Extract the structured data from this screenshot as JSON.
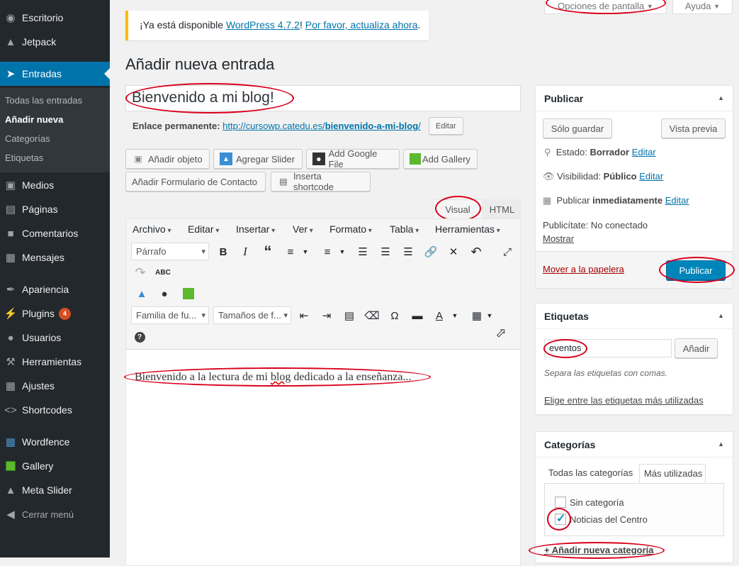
{
  "sidebar": {
    "items": [
      {
        "label": "Escritorio",
        "icon": "dashboard-icon"
      },
      {
        "label": "Jetpack",
        "icon": "jetpack-icon"
      },
      {
        "label": "Entradas",
        "icon": "pin-icon"
      },
      {
        "label": "Medios",
        "icon": "media-icon"
      },
      {
        "label": "Páginas",
        "icon": "pages-icon"
      },
      {
        "label": "Comentarios",
        "icon": "comments-icon"
      },
      {
        "label": "Mensajes",
        "icon": "messages-icon"
      },
      {
        "label": "Apariencia",
        "icon": "brush-icon"
      },
      {
        "label": "Plugins",
        "icon": "plugins-icon",
        "badge": "4"
      },
      {
        "label": "Usuarios",
        "icon": "users-icon"
      },
      {
        "label": "Herramientas",
        "icon": "tools-icon"
      },
      {
        "label": "Ajustes",
        "icon": "settings-icon"
      },
      {
        "label": "Shortcodes",
        "icon": "code-icon"
      },
      {
        "label": "Wordfence",
        "icon": "wordfence-icon"
      },
      {
        "label": "Gallery",
        "icon": "gallery-icon"
      },
      {
        "label": "Meta Slider",
        "icon": "slider-icon"
      },
      {
        "label": "Cerrar menú",
        "icon": "collapse-icon"
      }
    ],
    "submenu": [
      "Todas las entradas",
      "Añadir nueva",
      "Categorías",
      "Etiquetas"
    ]
  },
  "top": {
    "screen_options": "Opciones de pantalla",
    "help": "Ayuda"
  },
  "notice": {
    "prefix": "¡Ya está disponible ",
    "version_link": "WordPress 4.7.2",
    "sep": "! ",
    "update_link": "Por favor, actualiza ahora",
    "suffix": "."
  },
  "page_title": "Añadir nueva entrada",
  "post": {
    "title": "Bienvenido a mi blog!",
    "permalink_label": "Enlace permanente:",
    "permalink_base": "http://cursowp.catedu.es/",
    "permalink_slug": "bienvenido-a-mi-blog",
    "permalink_end": "/",
    "edit_label": "Editar"
  },
  "media_buttons": [
    "Añadir objeto",
    "Agregar Slider",
    "Add Google File",
    "Add Gallery",
    "Añadir Formulario de Contacto",
    "Inserta shortcode"
  ],
  "editor": {
    "tab_visual": "Visual",
    "tab_html": "HTML",
    "menus": [
      "Archivo",
      "Editar",
      "Insertar",
      "Ver",
      "Formato",
      "Tabla",
      "Herramientas"
    ],
    "format_select": "Párrafo",
    "font_family": "Familia de fu...",
    "font_size": "Tamaños de f...",
    "content_before": "Bienvenido a la lectura de mi ",
    "content_misspelled": "blog",
    "content_after": " dedicado a la enseñanza..."
  },
  "publish": {
    "heading": "Publicar",
    "save_draft": "Sólo guardar",
    "preview": "Vista previa",
    "status_label": "Estado: ",
    "status_value": "Borrador",
    "visibility_label": "Visibilidad: ",
    "visibility_value": "Público",
    "schedule_label": "Publicar ",
    "schedule_value": "inmediatamente",
    "edit": "Editar",
    "publicize_label": "Publicítate: No conectado",
    "show": "Mostrar",
    "trash": "Mover a la papelera",
    "publish_button": "Publicar"
  },
  "tags": {
    "heading": "Etiquetas",
    "input_value": "eventos",
    "add_button": "Añadir",
    "hint": "Separa las etiquetas con comas.",
    "most_used_link": "Elige entre las etiquetas más utilizadas"
  },
  "categories": {
    "heading": "Categorías",
    "tab_all": "Todas las categorías",
    "tab_popular": "Más utilizadas",
    "items": [
      {
        "label": "Sin categoría",
        "checked": false
      },
      {
        "label": "Noticias del Centro",
        "checked": true
      }
    ],
    "add_new": "+ Añadir nueva categoría"
  },
  "colors": {
    "accent": "#0073aa",
    "sidebar": "#23282d",
    "annotation": "#d9001b",
    "notice": "#ffb900"
  }
}
